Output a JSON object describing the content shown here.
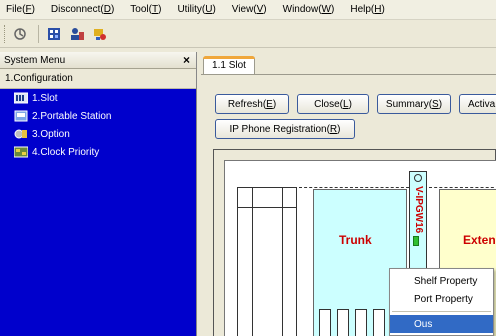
{
  "menubar": {
    "items": [
      {
        "label": "File(",
        "key": "F",
        "end": ")"
      },
      {
        "label": "Disconnect(",
        "key": "D",
        "end": ")"
      },
      {
        "label": "Tool(",
        "key": "T",
        "end": ")"
      },
      {
        "label": "Utility(",
        "key": "U",
        "end": ")"
      },
      {
        "label": "View(",
        "key": "V",
        "end": ")"
      },
      {
        "label": "Window(",
        "key": "W",
        "end": ")"
      },
      {
        "label": "Help(",
        "key": "H",
        "end": ")"
      }
    ]
  },
  "toolbar": {
    "icons": [
      "connect-icon",
      "grid-icon",
      "user-icon",
      "key-icon"
    ]
  },
  "system_menu": {
    "title": "System Menu",
    "close": "×",
    "section": "1.Configuration",
    "items": [
      {
        "label": "1.Slot",
        "icon": "slot-icon"
      },
      {
        "label": "2.Portable Station",
        "icon": "portable-station-icon"
      },
      {
        "label": "3.Option",
        "icon": "option-icon"
      },
      {
        "label": "4.Clock Priority",
        "icon": "clock-priority-icon"
      }
    ]
  },
  "tab": {
    "label": "1.1 Slot"
  },
  "buttons": {
    "refresh": {
      "text": "Refresh(",
      "key": "E",
      "end": ")"
    },
    "close": {
      "text": "Close(",
      "key": "L",
      "end": ")"
    },
    "summary": {
      "text": "Summary(",
      "key": "S",
      "end": ")"
    },
    "activate": {
      "text": "Activa"
    },
    "ip_phone": {
      "text": "IP Phone Registration(",
      "key": "R",
      "end": ")"
    }
  },
  "slot_view": {
    "trunk_label": "Trunk",
    "extension_label": "Extensio",
    "card_label": "V-IPGW16"
  },
  "context_menu": {
    "items": [
      "Shelf Property",
      "Port Property",
      "Ous"
    ],
    "selected": 2
  }
}
